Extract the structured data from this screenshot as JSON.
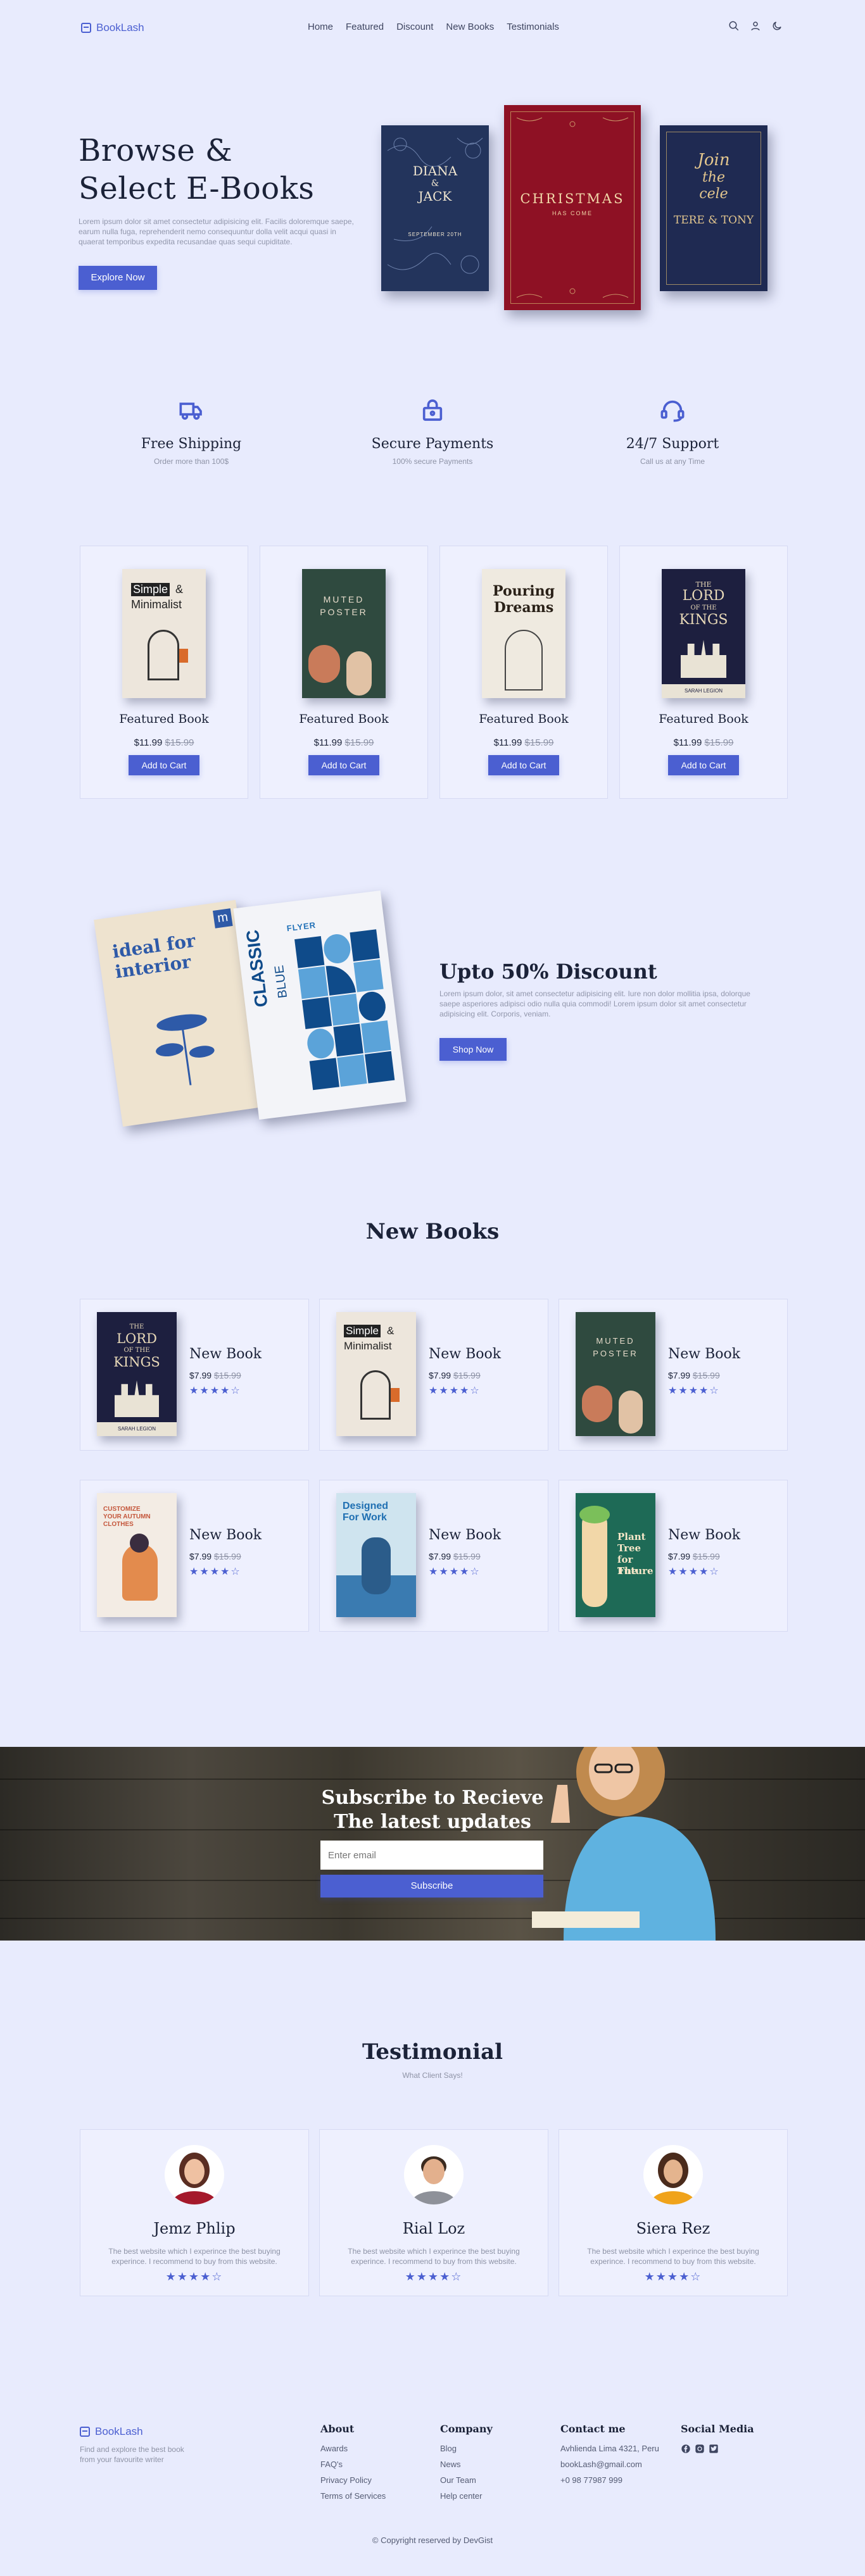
{
  "header": {
    "logo": "BookLash",
    "nav": [
      "Home",
      "Featured",
      "Discount",
      "New Books",
      "Testimonials"
    ],
    "icons": [
      "search-icon",
      "user-icon",
      "moon-icon"
    ]
  },
  "hero": {
    "title_line1": "Browse &",
    "title_line2": "Select E-Books",
    "text": "Lorem ipsum dolor sit amet consectetur adipisicing elit. Facilis doloremque saepe, earum nulla fuga, reprehenderit nemo consequuntur dolla velit acqui quasi in quaerat temporibus expedita recusandae quas sequi cupiditate.",
    "button": "Explore Now",
    "books": {
      "diana": {
        "title1": "DIANA",
        "amp": "&",
        "title2": "JACK",
        "sub": "SEPTEMBER 20TH"
      },
      "xmas": {
        "title": "CHRISTMAS",
        "sub": "HAS COME"
      },
      "terre": {
        "script1": "Join",
        "script2": "the",
        "script3": "cele",
        "title": "TERE & TONY"
      }
    }
  },
  "features": [
    {
      "icon": "truck-icon",
      "title": "Free Shipping",
      "sub": "Order more than 100$"
    },
    {
      "icon": "lock-icon",
      "title": "Secure Payments",
      "sub": "100% secure Payments"
    },
    {
      "icon": "headset-icon",
      "title": "24/7 Support",
      "sub": "Call us at any Time"
    }
  ],
  "featured": {
    "arrows": {
      "left": "←",
      "right": "→"
    },
    "items": [
      {
        "name": "Featured Book",
        "price": "$11.99",
        "old_price": "$15.99",
        "button": "Add to Cart",
        "cover": {
          "t1": "Simple",
          "t2": "&",
          "t3": "Minimalist"
        }
      },
      {
        "name": "Featured Book",
        "price": "$11.99",
        "old_price": "$15.99",
        "button": "Add to Cart",
        "cover": {
          "t1": "MUTED",
          "t2": "POSTER"
        }
      },
      {
        "name": "Featured Book",
        "price": "$11.99",
        "old_price": "$15.99",
        "button": "Add to Cart",
        "cover": {
          "t1": "Pouring",
          "t2": "Dreams"
        }
      },
      {
        "name": "Featured Book",
        "price": "$11.99",
        "old_price": "$15.99",
        "button": "Add to Cart",
        "cover": {
          "t1": "THE",
          "t2": "LORD",
          "t3": "OF THE",
          "t4": "KINGS",
          "t5": "SARAH LEGION"
        }
      }
    ]
  },
  "discount": {
    "title": "Upto 50% Discount",
    "text": "Lorem ipsum dolor, sit amet consectetur adipisicing elit. Iure non dolor mollitia ipsa, dolorque saepe asperiores adipisci odio nulla quia commodi! Lorem ipsum dolor sit amet consectetur adipisicing elit. Corporis, veniam.",
    "button": "Shop Now",
    "books": {
      "interior": {
        "t1": "ideal for",
        "t2": "interior",
        "brand": "m"
      },
      "classic": {
        "t1": "FLYER",
        "t2": "CLASSIC",
        "t3": "BLUE"
      }
    }
  },
  "new_books": {
    "title": "New Books",
    "items": [
      {
        "name": "New Book",
        "price": "$7.99",
        "old_price": "$15.99",
        "stars": "★★★★☆",
        "cover": {
          "t1": "THE",
          "t2": "LORD",
          "t3": "OF THE",
          "t4": "KINGS",
          "t5": "SARAH LEGION"
        }
      },
      {
        "name": "New Book",
        "price": "$7.99",
        "old_price": "$15.99",
        "stars": "★★★★☆",
        "cover": {
          "t1": "Simple",
          "t2": "&",
          "t3": "Minimalist"
        }
      },
      {
        "name": "New Book",
        "price": "$7.99",
        "old_price": "$15.99",
        "stars": "★★★★☆",
        "cover": {
          "t1": "MUTED",
          "t2": "POSTER"
        }
      },
      {
        "name": "New Book",
        "price": "$7.99",
        "old_price": "$15.99",
        "stars": "★★★★☆",
        "cover": {
          "t1": "CUSTOMIZE",
          "t2": "YOUR AUTUMN",
          "t3": "CLOTHES"
        }
      },
      {
        "name": "New Book",
        "price": "$7.99",
        "old_price": "$15.99",
        "stars": "★★★★☆",
        "cover": {
          "t1": "Designed",
          "t2": "For Work"
        }
      },
      {
        "name": "New Book",
        "price": "$7.99",
        "old_price": "$15.99",
        "stars": "★★★★☆",
        "cover": {
          "t1": "Plant",
          "t2": "Tree",
          "t3": "for The",
          "t4": "Future"
        }
      }
    ]
  },
  "subscribe": {
    "title_line1": "Subscribe to Recieve",
    "title_line2": "The latest updates",
    "placeholder": "Enter email",
    "button": "Subscribe"
  },
  "testimonial": {
    "title": "Testimonial",
    "subtitle": "What Client Says!",
    "items": [
      {
        "name": "Jemz Phlip",
        "text": "The best website which I experince the best buying experince. I recommend to buy from this website.",
        "stars": "★★★★☆"
      },
      {
        "name": "Rial Loz",
        "text": "The best website which I experince the best buying experince. I recommend to buy from this website.",
        "stars": "★★★★☆"
      },
      {
        "name": "Siera Rez",
        "text": "The best website which I experince the best buying experince. I recommend to buy from this website.",
        "stars": "★★★★☆"
      }
    ]
  },
  "footer": {
    "logo": "BookLash",
    "tagline": "Find and explore the best book from your favourite writer",
    "about": {
      "title": "About",
      "links": [
        "Awards",
        "FAQ's",
        "Privacy Policy",
        "Terms of Services"
      ]
    },
    "company": {
      "title": "Company",
      "links": [
        "Blog",
        "News",
        "Our Team",
        "Help center"
      ]
    },
    "contact": {
      "title": "Contact me",
      "address": "Avhlienda Lima 4321, Peru",
      "email": "bookLash@gmail.com",
      "phone": "+0 98 77987 999"
    },
    "social": {
      "title": "Social Media",
      "icons": [
        "facebook-icon",
        "instagram-icon",
        "twitter-icon"
      ]
    },
    "copyright": "© Copyright reserved by DevGist"
  },
  "colors": {
    "accent": "#4b5fd1",
    "background": "#e8ebfd",
    "navy": "#1b2238"
  }
}
